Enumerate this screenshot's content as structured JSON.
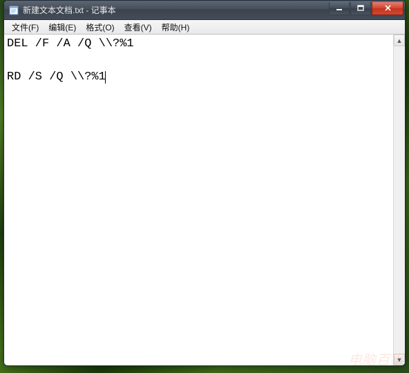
{
  "window": {
    "title": "新建文本文档.txt - 记事本",
    "controls": {
      "minimize_tip": "最小化",
      "maximize_tip": "最大化",
      "close_tip": "关闭"
    }
  },
  "menubar": {
    "items": [
      {
        "label": "文件(F)"
      },
      {
        "label": "编辑(E)"
      },
      {
        "label": "格式(O)"
      },
      {
        "label": "查看(V)"
      },
      {
        "label": "帮助(H)"
      }
    ]
  },
  "editor": {
    "content": "DEL /F /A /Q \\\\?%1\n\nRD /S /Q \\\\?%1"
  },
  "watermark": {
    "text": "电脑百事"
  }
}
